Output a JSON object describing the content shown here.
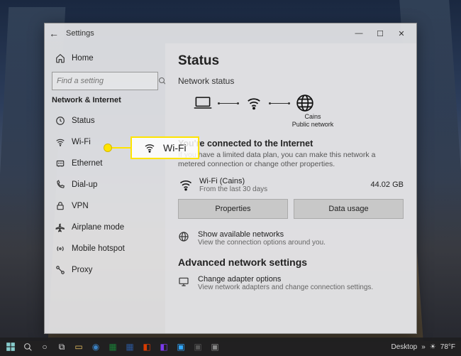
{
  "window": {
    "title": "Settings",
    "min": "—",
    "max": "☐",
    "close": "✕"
  },
  "sidebar": {
    "home": "Home",
    "search_placeholder": "Find a setting",
    "category": "Network & Internet",
    "items": [
      {
        "label": "Status"
      },
      {
        "label": "Wi-Fi"
      },
      {
        "label": "Ethernet"
      },
      {
        "label": "Dial-up"
      },
      {
        "label": "VPN"
      },
      {
        "label": "Airplane mode"
      },
      {
        "label": "Mobile hotspot"
      },
      {
        "label": "Proxy"
      }
    ]
  },
  "main": {
    "heading": "Status",
    "subheading": "Network status",
    "diagram": {
      "ssid": "Cains",
      "type": "Public network"
    },
    "connected_title": "You're connected to the Internet",
    "connected_desc": "If you have a limited data plan, you can make this network a metered connection or change other properties.",
    "usage": {
      "name": "Wi-Fi (Cains)",
      "period": "From the last 30 days",
      "amount": "44.02 GB"
    },
    "btn_properties": "Properties",
    "btn_usage": "Data usage",
    "show_networks_title": "Show available networks",
    "show_networks_desc": "View the connection options around you.",
    "advanced_heading": "Advanced network settings",
    "adapter_title": "Change adapter options",
    "adapter_desc": "View network adapters and change connection settings."
  },
  "callout": {
    "label": "Wi-Fi"
  },
  "taskbar": {
    "tray_label": "Desktop",
    "temp": "78°F"
  }
}
